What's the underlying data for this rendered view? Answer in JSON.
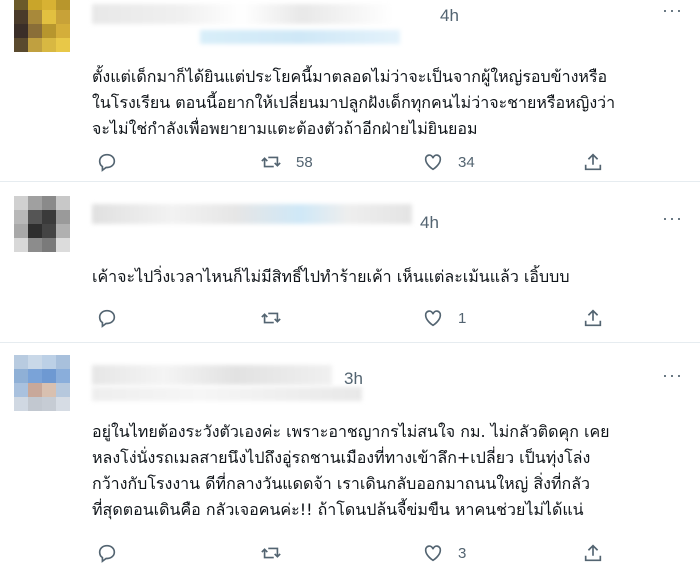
{
  "tweets": [
    {
      "time": "4h",
      "text": "ตั้งแต่เด็กมาก็ได้ยินแต่ประโยคนี้มาตลอดไม่ว่าจะเป็นจากผู้ใหญ่รอบข้างหรือ\nในโรงเรียน ตอนนี้อยากให้เปลี่ยนมาปลูกฝังเด็กทุกคนไม่ว่าจะชายหรือหญิงว่า\nจะไม่ใช่กำลังเพื่อพยายามแตะต้องตัวถ้าอีกฝ่ายไม่ยินยอม",
      "retweets": "58",
      "likes": "34"
    },
    {
      "time": "4h",
      "text": "เค้าจะไปวิ่งเวลาไหนก็ไม่มีสิทธิ์ไปทำร้ายเค้า เห็นแต่ละเม้นแล้ว เอิ้บบบ",
      "retweets": "",
      "likes": "1"
    },
    {
      "time": "3h",
      "text": "อยู่ในไทยต้องระวังตัวเองค่ะ เพราะอาชญากรไม่สนใจ กม. ไม่กลัวติดคุก เคย\nหลงโง่นั่งรถเมลสายนึงไปถึงอู่รถชานเมืองที่ทางเข้าลึก+เปลี่ยว เป็นทุ่งโล่ง\nกว้างกับโรงงาน ดีที่กลางวันแดดจ้า เราเดินกลับออกมาถนนใหญ่ สิ่งที่กลัว\nที่สุดตอนเดินคือ กลัวเจอคนค่ะ!! ถ้าโดนปล้นจี้ข่มขืน หาคนช่วยไม่ได้แน่",
      "retweets": "",
      "likes": "3"
    }
  ],
  "icons": {
    "reply": "reply-icon",
    "retweet": "retweet-icon",
    "like": "heart-icon",
    "share": "share-icon",
    "more": "more-icon"
  },
  "colors": {
    "icon_gray": "#536471",
    "divider": "#e6ecf0",
    "blur_blue": "#cfe8f7"
  }
}
